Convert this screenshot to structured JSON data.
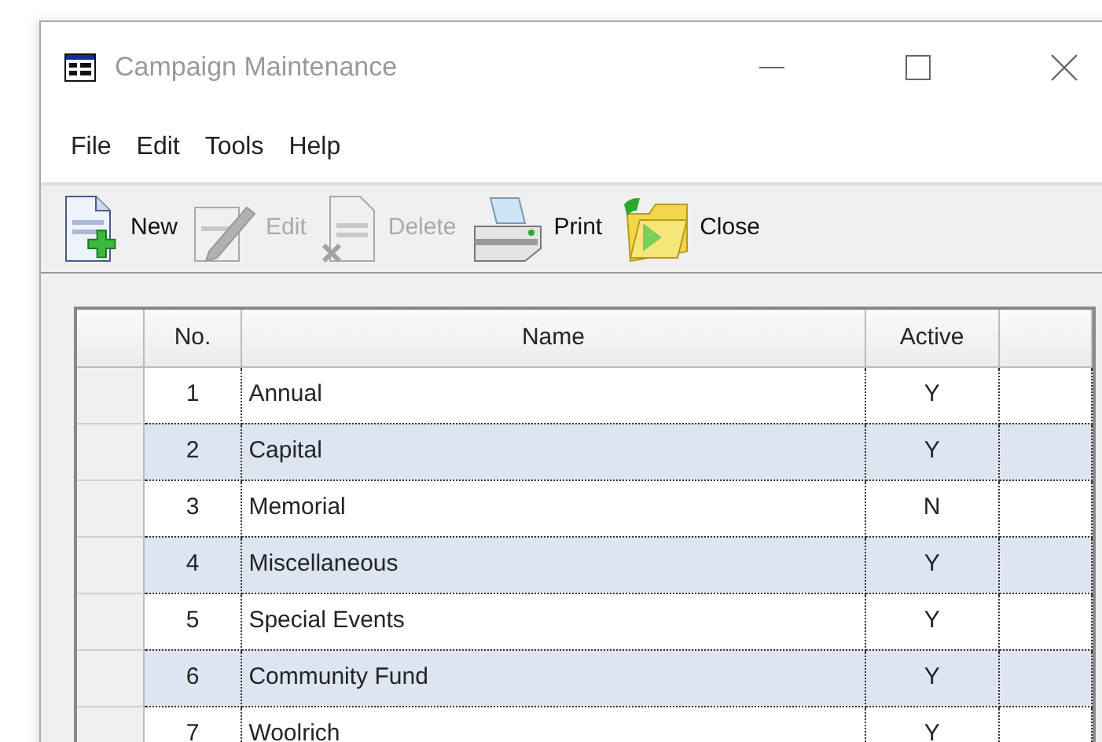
{
  "window": {
    "title": "Campaign Maintenance"
  },
  "menu": [
    "File",
    "Edit",
    "Tools",
    "Help"
  ],
  "toolbar": [
    {
      "kind": "new",
      "label": "New",
      "disabled": false
    },
    {
      "kind": "edit",
      "label": "Edit",
      "disabled": true
    },
    {
      "kind": "delete",
      "label": "Delete",
      "disabled": true
    },
    {
      "kind": "print",
      "label": "Print",
      "disabled": false
    },
    {
      "kind": "close",
      "label": "Close",
      "disabled": false
    }
  ],
  "table": {
    "columns": [
      "No.",
      "Name",
      "Active"
    ],
    "rows": [
      [
        "1",
        "Annual",
        "Y"
      ],
      [
        "2",
        "Capital",
        "Y"
      ],
      [
        "3",
        "Memorial",
        "N"
      ],
      [
        "4",
        "Miscellaneous",
        "Y"
      ],
      [
        "5",
        "Special Events",
        "Y"
      ],
      [
        "6",
        "Community Fund",
        "Y"
      ],
      [
        "7",
        "Woolrich",
        "Y"
      ]
    ]
  }
}
